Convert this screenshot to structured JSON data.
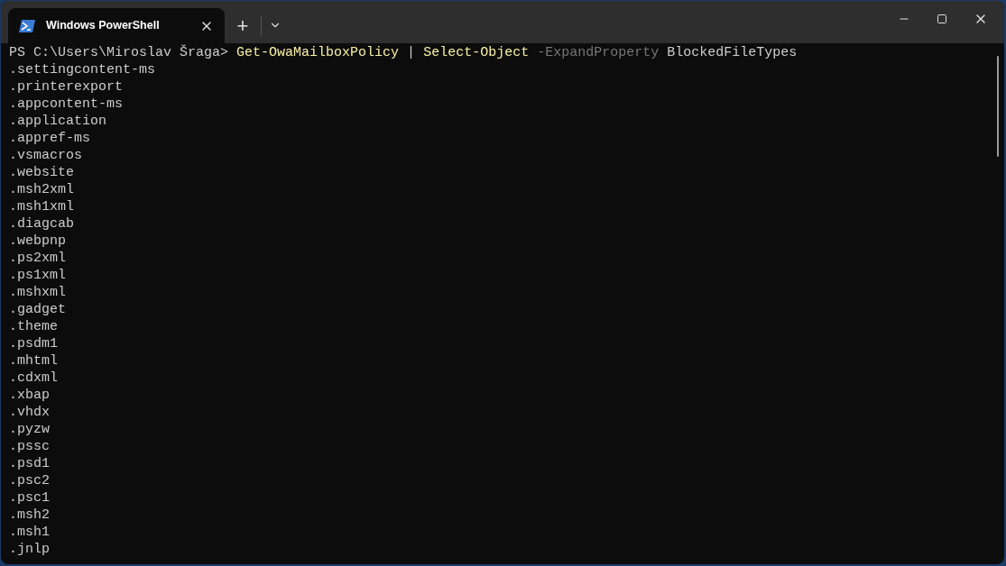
{
  "window": {
    "tabs": [
      {
        "title": "Windows PowerShell",
        "selected": true
      }
    ],
    "new_tab": "+"
  },
  "terminal": {
    "prompt": "PS C:\\Users\\Miroslav Šraga> ",
    "command": [
      {
        "kind": "command",
        "text": "Get-OwaMailboxPolicy"
      },
      {
        "kind": "operator",
        "text": "|"
      },
      {
        "kind": "command",
        "text": "Select-Object"
      },
      {
        "kind": "parameter",
        "text": "-ExpandProperty"
      },
      {
        "kind": "argument",
        "text": "BlockedFileTypes"
      }
    ],
    "output": [
      ".settingcontent-ms",
      ".printerexport",
      ".appcontent-ms",
      ".application",
      ".appref-ms",
      ".vsmacros",
      ".website",
      ".msh2xml",
      ".msh1xml",
      ".diagcab",
      ".webpnp",
      ".ps2xml",
      ".ps1xml",
      ".mshxml",
      ".gadget",
      ".theme",
      ".psdm1",
      ".mhtml",
      ".cdxml",
      ".xbap",
      ".vhdx",
      ".pyzw",
      ".pssc",
      ".psd1",
      ".psc2",
      ".psc1",
      ".msh2",
      ".msh1",
      ".jnlp"
    ]
  }
}
